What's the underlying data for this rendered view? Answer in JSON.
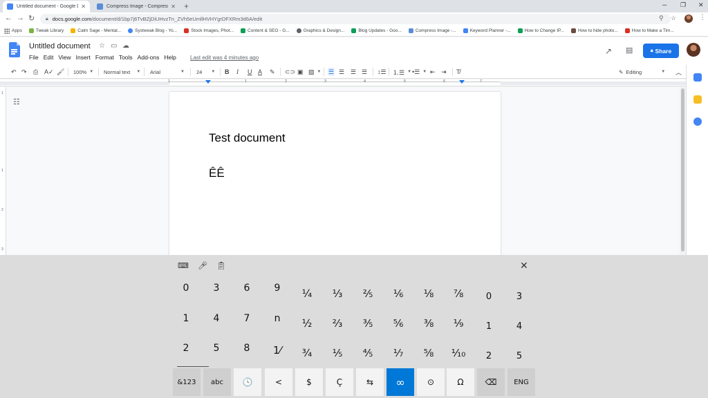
{
  "browser": {
    "tabs": [
      {
        "title": "Untitled document - Google Do",
        "color": "#4285f4",
        "active": true
      },
      {
        "title": "Compress Image - Compressnow",
        "color": "#5b8dd6",
        "active": false
      }
    ],
    "new_tab_label": "+",
    "url_host": "docs.google.com",
    "url_path": "/document/d/1bp7j6TvBZjDiUHvzTn_ZVh5eUmllHVHYgrDFXRm3d6A/edit",
    "bookmarks": [
      {
        "label": "Apps",
        "color": ""
      },
      {
        "label": "Tweak Library",
        "color": "#7cb342"
      },
      {
        "label": "Calm Sage - Mental...",
        "color": "#f4b400"
      },
      {
        "label": "Systweak Blog - Yo...",
        "color": "#4285f4"
      },
      {
        "label": "Stock Images, Phot...",
        "color": "#d93025"
      },
      {
        "label": "Content & SEO - G...",
        "color": "#0f9d58"
      },
      {
        "label": "Graphics & Design...",
        "color": "#5f6368"
      },
      {
        "label": "Blog Updates - Goo...",
        "color": "#0f9d58"
      },
      {
        "label": "Compress Image -...",
        "color": "#5b8dd6"
      },
      {
        "label": "Keyword Planner -...",
        "color": "#4285f4"
      },
      {
        "label": "How to Change IP...",
        "color": "#0f9d58"
      },
      {
        "label": "How to hide photo...",
        "color": "#6d4c41"
      },
      {
        "label": "How to Make a Tim...",
        "color": "#d93025"
      }
    ]
  },
  "docs": {
    "title": "Untitled document",
    "menu": [
      "File",
      "Edit",
      "View",
      "Insert",
      "Format",
      "Tools",
      "Add-ons",
      "Help"
    ],
    "last_edit": "Last edit was 4 minutes ago",
    "share_label": "Share",
    "zoom": "100%",
    "style": "Normal text",
    "font": "Arial",
    "font_size": "24",
    "mode": "Editing",
    "ruler_numbers": [
      "1",
      "1",
      "2",
      "3",
      "4",
      "5",
      "6",
      "7"
    ],
    "vruler_numbers": [
      "1",
      "1",
      "2",
      "3"
    ],
    "accent_color": "#1a73e8"
  },
  "document": {
    "heading": "Test document",
    "line2": "ÊÊ"
  },
  "keyboard": {
    "column_keys": [
      "0",
      "3",
      "6",
      "9",
      "1",
      "4",
      "7",
      "n",
      "2",
      "5",
      "8",
      "1⁄"
    ],
    "fraction_keys": [
      "¼",
      "⅓",
      "⅖",
      "⅙",
      "⅛",
      "⅞",
      "½",
      "⅔",
      "⅗",
      "⅚",
      "⅜",
      "⅑",
      "¾",
      "⅕",
      "⅘",
      "⅐",
      "⅝",
      "⅒"
    ],
    "super_keys": [
      "0",
      "3",
      "1",
      "4",
      "2",
      "5"
    ],
    "bottom_keys": [
      {
        "label": "&123",
        "name": "symbols-toggle-key"
      },
      {
        "label": "abc",
        "name": "abc-key"
      },
      {
        "label": "🕓",
        "name": "recent-icon"
      },
      {
        "label": "<",
        "name": "less-than-key"
      },
      {
        "label": "$",
        "name": "dollar-key"
      },
      {
        "label": "Ç",
        "name": "c-cedilla-key"
      },
      {
        "label": "⇆",
        "name": "swap-icon"
      },
      {
        "label": "∞",
        "name": "infinity-key"
      },
      {
        "label": "⊙",
        "name": "circled-dot-key"
      },
      {
        "label": "Ω",
        "name": "omega-key"
      },
      {
        "label": "⌫",
        "name": "backspace-icon"
      },
      {
        "label": "ENG",
        "name": "language-key"
      }
    ],
    "selected_color": "#0078d7"
  }
}
